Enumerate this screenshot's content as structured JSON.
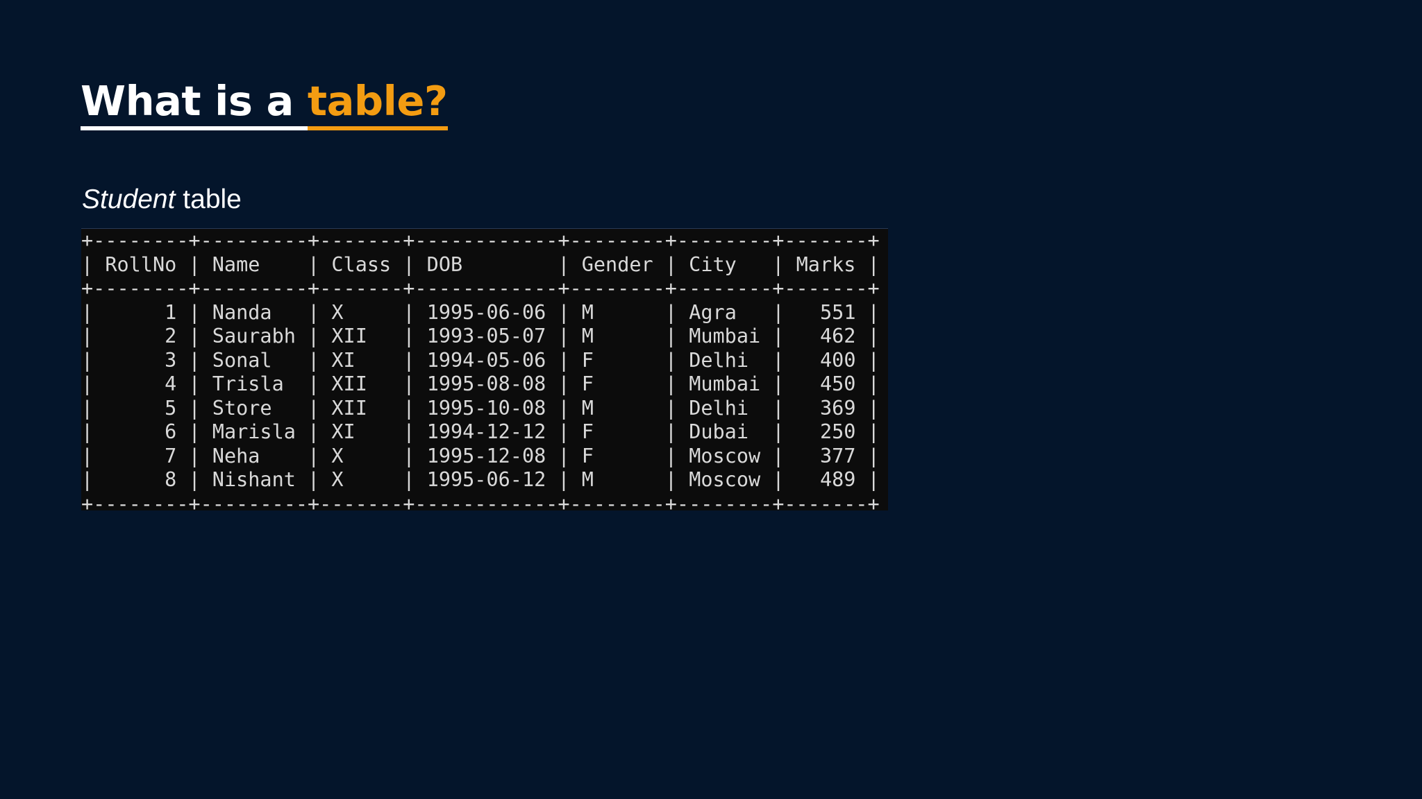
{
  "slide": {
    "title_part1": "What is a ",
    "title_part2": "table?",
    "subtitle_italic": "Student",
    "subtitle_rest": " table"
  },
  "table": {
    "columns": [
      "RollNo",
      "Name",
      "Class",
      "DOB",
      "Gender",
      "City",
      "Marks"
    ],
    "rows": [
      [
        "1",
        "Nanda",
        "X",
        "1995-06-06",
        "M",
        "Agra",
        "551"
      ],
      [
        "2",
        "Saurabh",
        "XII",
        "1993-05-07",
        "M",
        "Mumbai",
        "462"
      ],
      [
        "3",
        "Sonal",
        "XI",
        "1994-05-06",
        "F",
        "Delhi",
        "400"
      ],
      [
        "4",
        "Trisla",
        "XII",
        "1995-08-08",
        "F",
        "Mumbai",
        "450"
      ],
      [
        "5",
        "Store",
        "XII",
        "1995-10-08",
        "M",
        "Delhi",
        "369"
      ],
      [
        "6",
        "Marisla",
        "XI",
        "1994-12-12",
        "F",
        "Dubai",
        "250"
      ],
      [
        "7",
        "Neha",
        "X",
        "1995-12-08",
        "F",
        "Moscow",
        "377"
      ],
      [
        "8",
        "Nishant",
        "X",
        "1995-06-12",
        "M",
        "Moscow",
        "489"
      ]
    ]
  },
  "colors": {
    "background": "#04152b",
    "accent": "#f39c12",
    "console_bg": "#0c0c0c",
    "console_text": "#d9d9d9"
  }
}
